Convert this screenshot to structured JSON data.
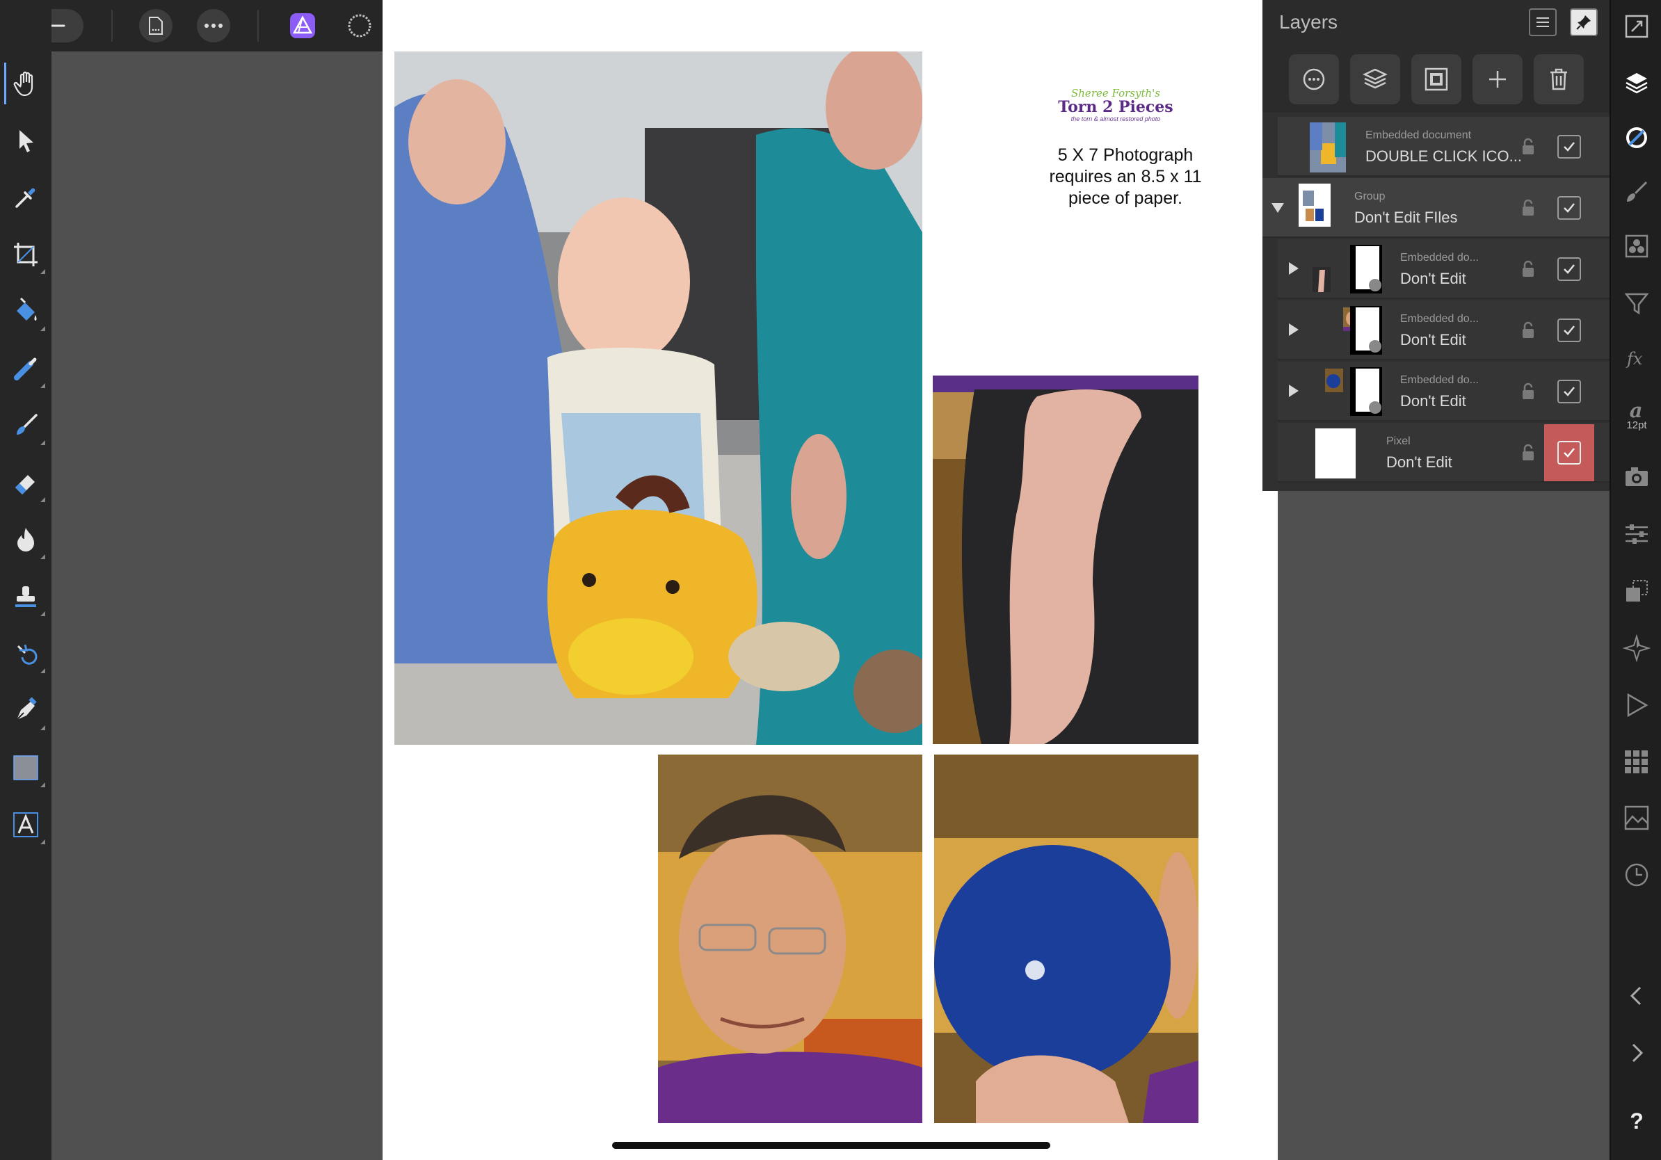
{
  "app": {
    "name": "Affinity Photo"
  },
  "top_toolbar": {
    "back_icon": "back-arrow-icon",
    "document_icon": "document-icon",
    "more_icon": "more-icon",
    "personas": [
      "photo-persona-icon",
      "liquify-persona-icon",
      "develop-persona-icon",
      "tone-mapping-persona-icon",
      "export-persona-icon",
      "window-layout-icon"
    ]
  },
  "left_tools": [
    "view-tool-icon",
    "move-tool-icon",
    "color-picker-tool-icon",
    "crop-tool-icon",
    "flood-fill-tool-icon",
    "selection-brush-tool-icon",
    "paint-brush-tool-icon",
    "erase-brush-tool-icon",
    "dodge-burn-tool-icon",
    "clone-tool-icon",
    "undo-brush-tool-icon",
    "pen-tool-icon",
    "rectangle-tool-icon",
    "artistic-text-tool-icon"
  ],
  "canvas": {
    "logo_script": "Sheree Forsyth's",
    "logo_title": "Torn 2 Pieces",
    "logo_tagline": "the torn & almost restored photo",
    "print_note_line1": "5 X 7 Photograph",
    "print_note_line2": "requires an 8.5 x 11",
    "print_note_line3": "piece of paper.",
    "photo_family_alt": "family-photo",
    "photo_arm_alt": "arm-photo",
    "photo_man_alt": "man-portrait-photo",
    "photo_ball_alt": "bowling-ball-photo"
  },
  "layers_panel": {
    "title": "Layers",
    "layers": [
      {
        "type": "Embedded document",
        "name": "DOUBLE CLICK ICO...",
        "visible": true
      },
      {
        "type": "Group",
        "name": "Don't Edit FIles",
        "visible": true,
        "expanded": true
      },
      {
        "type": "Embedded do...",
        "name": "Don't Edit",
        "visible": true
      },
      {
        "type": "Embedded do...",
        "name": "Don't Edit",
        "visible": true
      },
      {
        "type": "Embedded do...",
        "name": "Don't Edit",
        "visible": true
      },
      {
        "type": "Pixel",
        "name": "Don't Edit",
        "visible": true,
        "selected": true
      }
    ]
  },
  "right_bar": {
    "font_size": "12pt",
    "help": "?"
  },
  "colors": {
    "accent": "#6fa8ff",
    "persona_active": "#8b5cf6",
    "selection_red": "#c55a5a"
  }
}
